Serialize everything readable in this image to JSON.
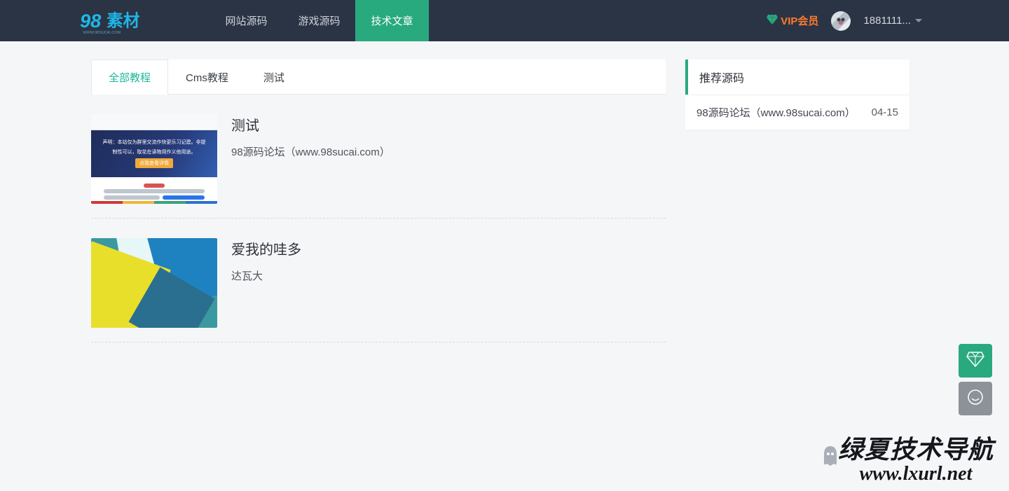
{
  "header": {
    "logo_text_main": "98",
    "logo_text_sub": "素材",
    "nav": [
      {
        "label": "网站源码",
        "active": false
      },
      {
        "label": "游戏源码",
        "active": false
      },
      {
        "label": "技术文章",
        "active": true
      }
    ],
    "vip_label": "VIP会员",
    "username": "1881111..."
  },
  "tabs": [
    {
      "label": "全部教程",
      "active": true
    },
    {
      "label": "Cms教程",
      "active": false
    },
    {
      "label": "测试",
      "active": false
    }
  ],
  "articles": [
    {
      "title": "测试",
      "desc": "98源码论坛（www.98sucai.com）",
      "thumb_type": "forum",
      "thumb_lines": [
        "声明：本站仅为群里交流作快更乐习记建。非提",
        "制性可以，取花在读物用作义他用途。"
      ],
      "thumb_badge": "点我查看详情"
    },
    {
      "title": "爱我的哇多",
      "desc": "达瓦大",
      "thumb_type": "material"
    }
  ],
  "sidebar": {
    "title": "推荐源码",
    "items": [
      {
        "title": "98源码论坛（www.98sucai.com）",
        "date": "04-15"
      }
    ]
  },
  "watermark": {
    "line1": "绿夏技术导航",
    "line2": "www.lxurl.net"
  }
}
